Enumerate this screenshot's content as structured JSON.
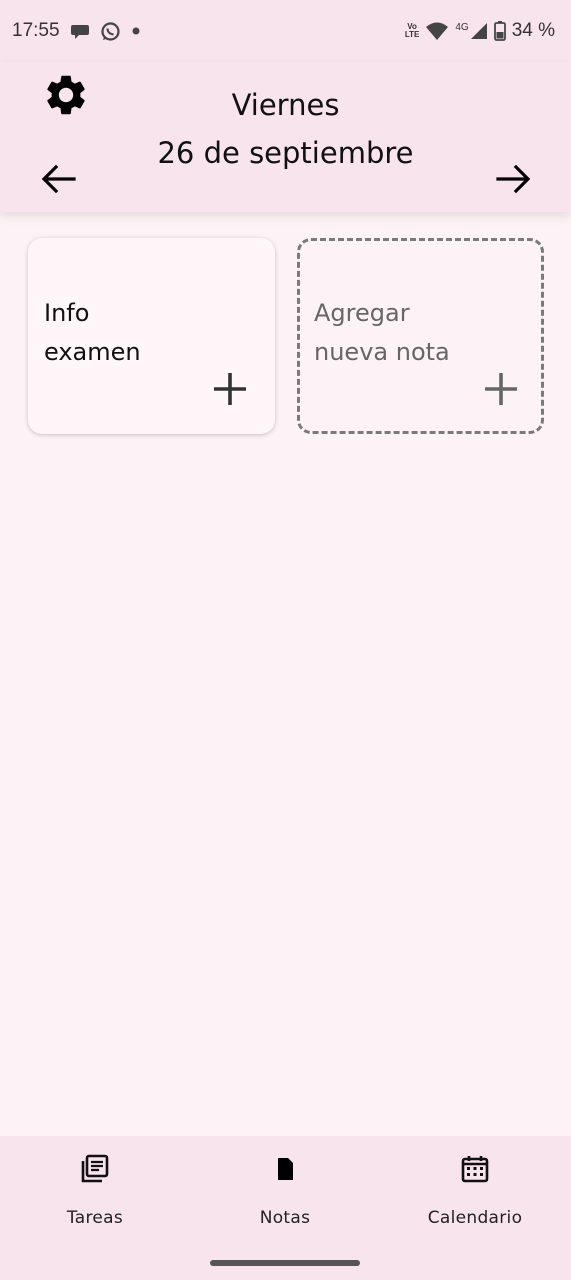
{
  "status_bar": {
    "time": "17:55",
    "volte_top": "Vo",
    "volte_bottom": "LTE",
    "network": "4G",
    "battery": "34 %",
    "icons": [
      "chat-bubble-icon",
      "whatsapp-icon",
      "dot-icon",
      "volte-icon",
      "wifi-icon",
      "signal-icon",
      "battery-icon"
    ]
  },
  "header": {
    "day": "Viernes",
    "date": "26 de septiembre",
    "icons": [
      "gear-icon",
      "arrow-left-icon",
      "arrow-right-icon"
    ]
  },
  "notes": [
    {
      "title_line1": "Info",
      "title_line2": "examen"
    }
  ],
  "add_note": {
    "line1": "Agregar",
    "line2": "nueva nota"
  },
  "bottom_nav": {
    "items": [
      {
        "label": "Tareas",
        "icon": "article-list-icon"
      },
      {
        "label": "Notas",
        "icon": "document-icon"
      },
      {
        "label": "Calendario",
        "icon": "calendar-icon"
      }
    ]
  },
  "colors": {
    "background": "#fdf3f6",
    "header": "#f8e4ec",
    "text": "#111111",
    "muted_text": "#666666",
    "dashed_border": "#7a7a7a"
  }
}
